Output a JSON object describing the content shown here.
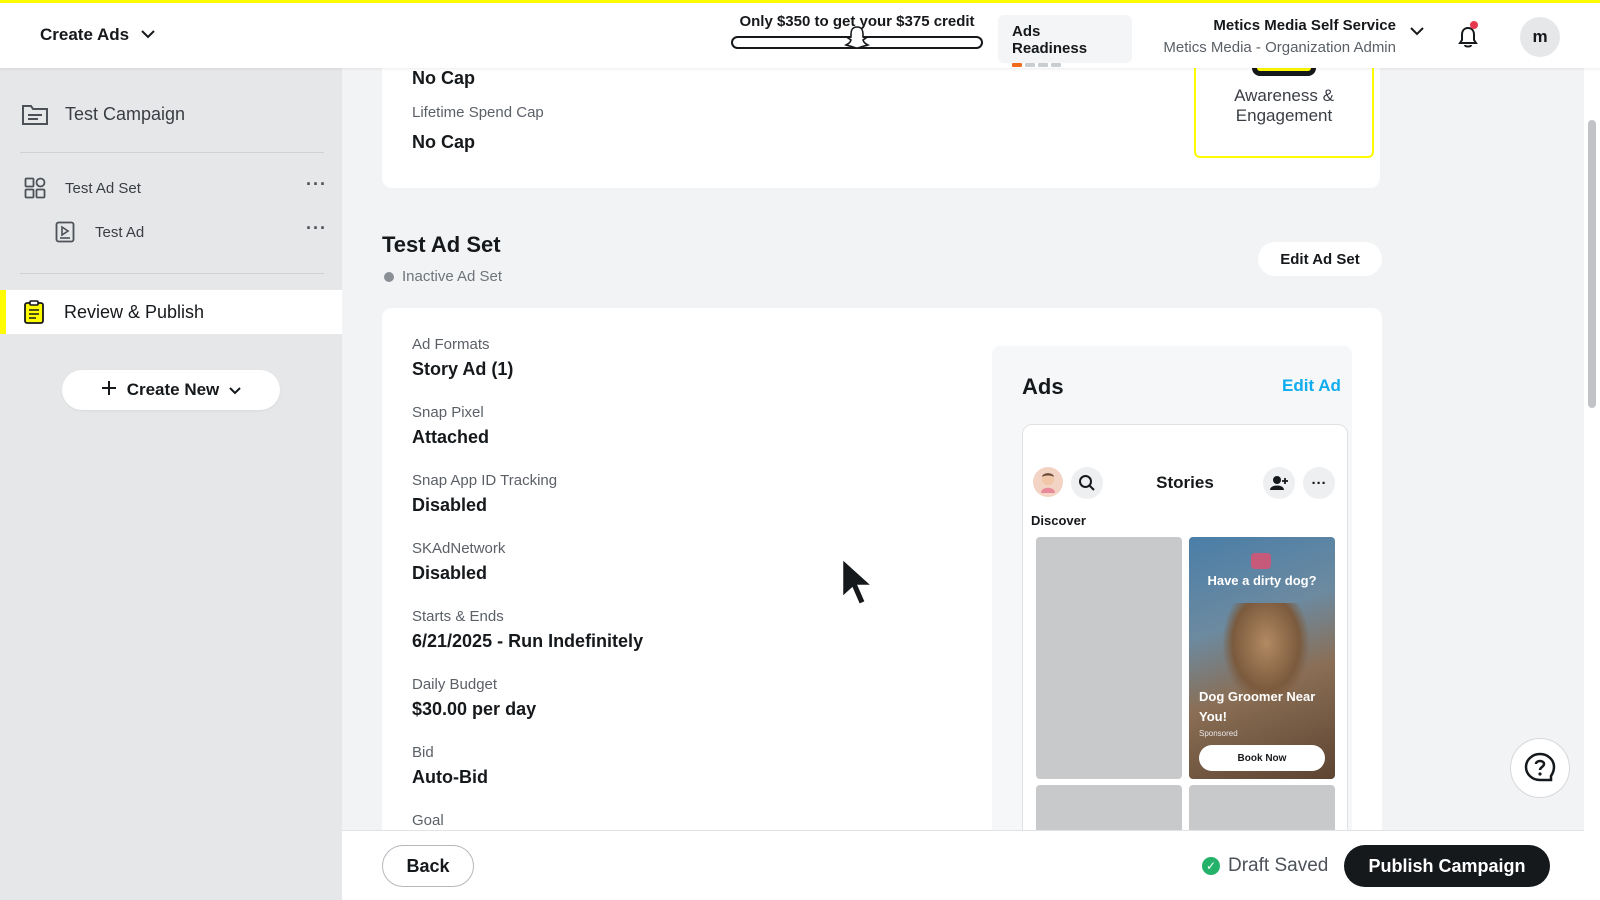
{
  "topbar": {
    "menu_title": "Create Ads",
    "credit_text": "Only $350 to get your $375 credit",
    "credit_progress": 0,
    "readiness_label": "Ads Readiness",
    "readiness_steps": [
      1,
      0,
      0,
      0
    ],
    "org_name": "Metics Media Self Service",
    "org_role": "Metics Media - Organization Admin",
    "avatar_initial": "m",
    "accent_color": "#fffc00",
    "notification_dot_color": "#e8384f"
  },
  "sidebar": {
    "campaign": "Test Campaign",
    "ad_set": "Test Ad Set",
    "ad": "Test Ad",
    "review": "Review & Publish",
    "create_new": "Create New"
  },
  "campaign_card": {
    "daily_cap_value": "No Cap",
    "lifetime_cap_label": "Lifetime Spend Cap",
    "lifetime_cap_value": "No Cap",
    "objective": "Awareness & Engagement"
  },
  "ad_set": {
    "title": "Test Ad Set",
    "status": "Inactive Ad Set",
    "edit_label": "Edit Ad Set",
    "details": [
      {
        "label": "Ad Formats",
        "value": "Story Ad (1)"
      },
      {
        "label": "Snap Pixel",
        "value": "Attached"
      },
      {
        "label": "Snap App ID Tracking",
        "value": "Disabled"
      },
      {
        "label": "SKAdNetwork",
        "value": "Disabled"
      },
      {
        "label": "Starts & Ends",
        "value": "6/21/2025 - Run Indefinitely"
      },
      {
        "label": "Daily Budget",
        "value": "$30.00 per day"
      },
      {
        "label": "Bid",
        "value": "Auto-Bid"
      },
      {
        "label": "Goal",
        "value": ""
      }
    ]
  },
  "ads_panel": {
    "title": "Ads",
    "edit_label": "Edit Ad",
    "preview": {
      "header_title": "Stories",
      "section": "Discover",
      "ad_headline": "Have a dirty dog?",
      "ad_name": "Dog Groomer Near You!",
      "sponsored": "Sponsored",
      "cta": "Book Now"
    }
  },
  "bottombar": {
    "back_label": "Back",
    "draft_status": "Draft Saved",
    "publish_label": "Publish Campaign"
  }
}
